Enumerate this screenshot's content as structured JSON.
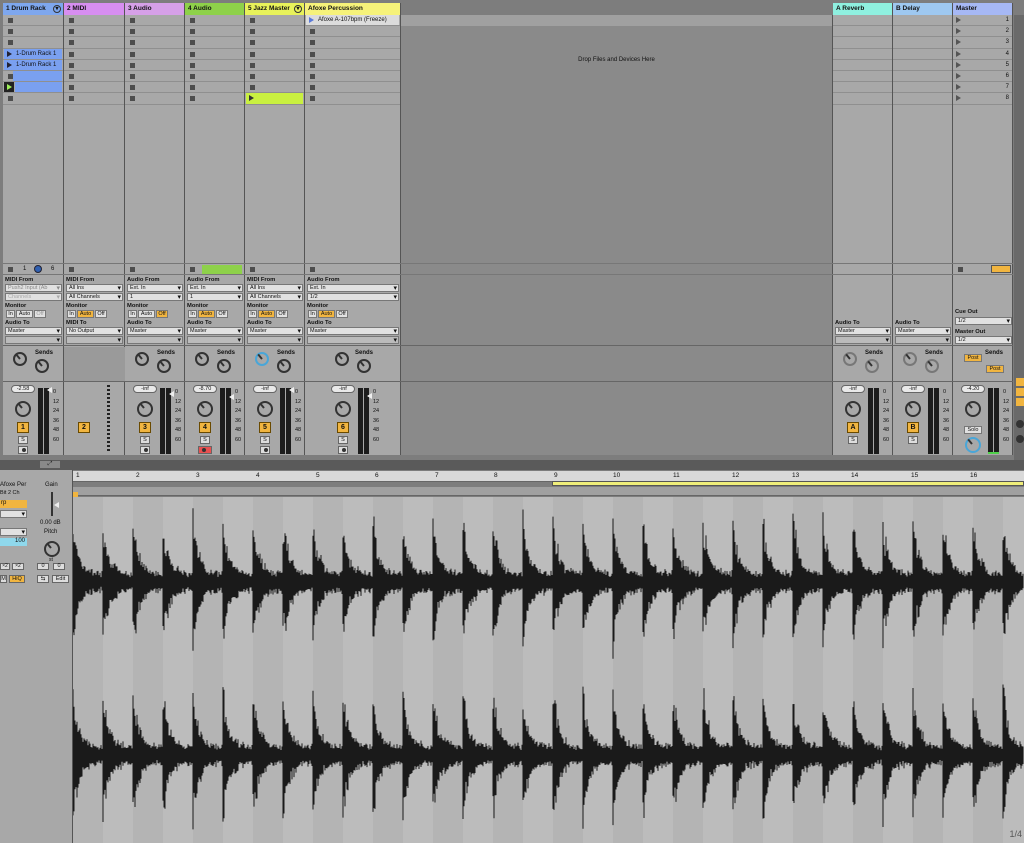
{
  "colors": {
    "drum_rack": "#7ea7ee",
    "midi": "#d78ef0",
    "audio3": "#d6a0e8",
    "audio4": "#8ed14a",
    "jazz": "#e8f25a",
    "afoxe": "#f6f27a",
    "reverb": "#8ff0e0",
    "delay": "#9ec8f0",
    "master": "#a6b8f5",
    "accent": "#f1b540",
    "clip_blue": "#7aa0f0",
    "clip_green": "#c9f040"
  },
  "tracks": [
    {
      "name": "1 Drum Rack",
      "number": "1",
      "volume": "-2.58"
    },
    {
      "name": "2 MIDI",
      "number": "2",
      "volume": ""
    },
    {
      "name": "3 Audio",
      "number": "3",
      "volume": "-inf"
    },
    {
      "name": "4 Audio",
      "number": "4",
      "volume": "-8.70"
    },
    {
      "name": "5 Jazz Master",
      "number": "5",
      "volume": "-inf"
    },
    {
      "name": "Afoxe Percussion",
      "number": "6",
      "volume": "-inf"
    }
  ],
  "returns": [
    {
      "name": "A Reverb",
      "letter": "A",
      "volume": "-inf"
    },
    {
      "name": "B Delay",
      "letter": "B",
      "volume": "-inf"
    },
    {
      "name": "Master",
      "volume": "-4.20"
    }
  ],
  "clips": {
    "drum1": "1-Drum Rack 1",
    "drum2": "1-Drum Rack 1",
    "afoxe": "Afoxe A-107bpm (Freeze)"
  },
  "drop_text": "Drop Files and Devices Here",
  "scene_numbers": [
    "1",
    "2",
    "3",
    "4",
    "5",
    "6",
    "7",
    "8"
  ],
  "io": {
    "midi_from": "MIDI From",
    "audio_from": "Audio From",
    "monitor": "Monitor",
    "audio_to": "Audio To",
    "midi_to": "MIDI To",
    "push_input": "Push2 Input (Ab",
    "channels": "Channels",
    "all_ins": "All Ins",
    "all_channels": "All Channels",
    "ext_in": "Ext. In",
    "ch1": "1",
    "ch12": "1/2",
    "master": "Master",
    "no_output": "No Output",
    "in": "In",
    "auto": "Auto",
    "off": "Off",
    "cue_out": "Cue Out",
    "master_out": "Master Out",
    "post": "Post",
    "solo": "Solo",
    "s": "S"
  },
  "sends_label": "Sends",
  "meter_ticks": [
    "0",
    "12",
    "24",
    "36",
    "48",
    "60"
  ],
  "drum_counts": {
    "a": "1",
    "b": "6"
  },
  "clip_view": {
    "name": "Afoxe Per",
    "bit": "Bit",
    "ch": "2 Ch",
    "gain_label": "Gain",
    "gain_value": "0.00 dB",
    "pitch_label": "Pitch",
    "st": "st",
    "pitch_a": "0",
    "pitch_b": "0",
    "warp_value": "100",
    "hiq": "HiQ",
    "edit": "Edit",
    "ram": "M",
    "x2a": "×2",
    "x2b": "×2",
    "rp": "rp"
  },
  "ruler": [
    "1",
    "2",
    "3",
    "4",
    "5",
    "6",
    "7",
    "8",
    "9",
    "10",
    "11",
    "12",
    "13",
    "14",
    "15",
    "16"
  ],
  "page_fraction": "1/4"
}
